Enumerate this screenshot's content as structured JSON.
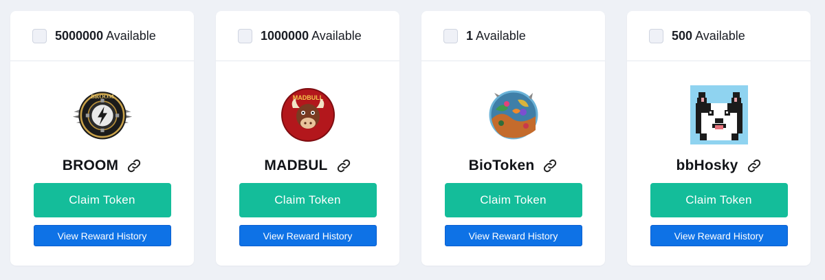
{
  "available_suffix": "Available",
  "colors": {
    "page_bg": "#eef1f6",
    "claim_button": "#14bd9a",
    "history_button": "#0e72e6"
  },
  "cards": [
    {
      "count": "5000000",
      "name": "BROOM",
      "logo_icon": "broom-winged-lightning-emblem",
      "logo_text": "BROOM",
      "claim_label": "Claim Token",
      "history_label": "View Reward History"
    },
    {
      "count": "1000000",
      "name": "MADBUL",
      "logo_icon": "red-bull-face-emblem",
      "logo_text": "MADBULL",
      "claim_label": "Claim Token",
      "history_label": "View Reward History"
    },
    {
      "count": "1",
      "name": "BioToken",
      "logo_icon": "colorful-reef-scene-emblem",
      "claim_label": "Claim Token",
      "history_label": "View Reward History"
    },
    {
      "count": "500",
      "name": "bbHosky",
      "logo_icon": "pixel-husky-dog-icon",
      "claim_label": "Claim Token",
      "history_label": "View Reward History"
    }
  ]
}
